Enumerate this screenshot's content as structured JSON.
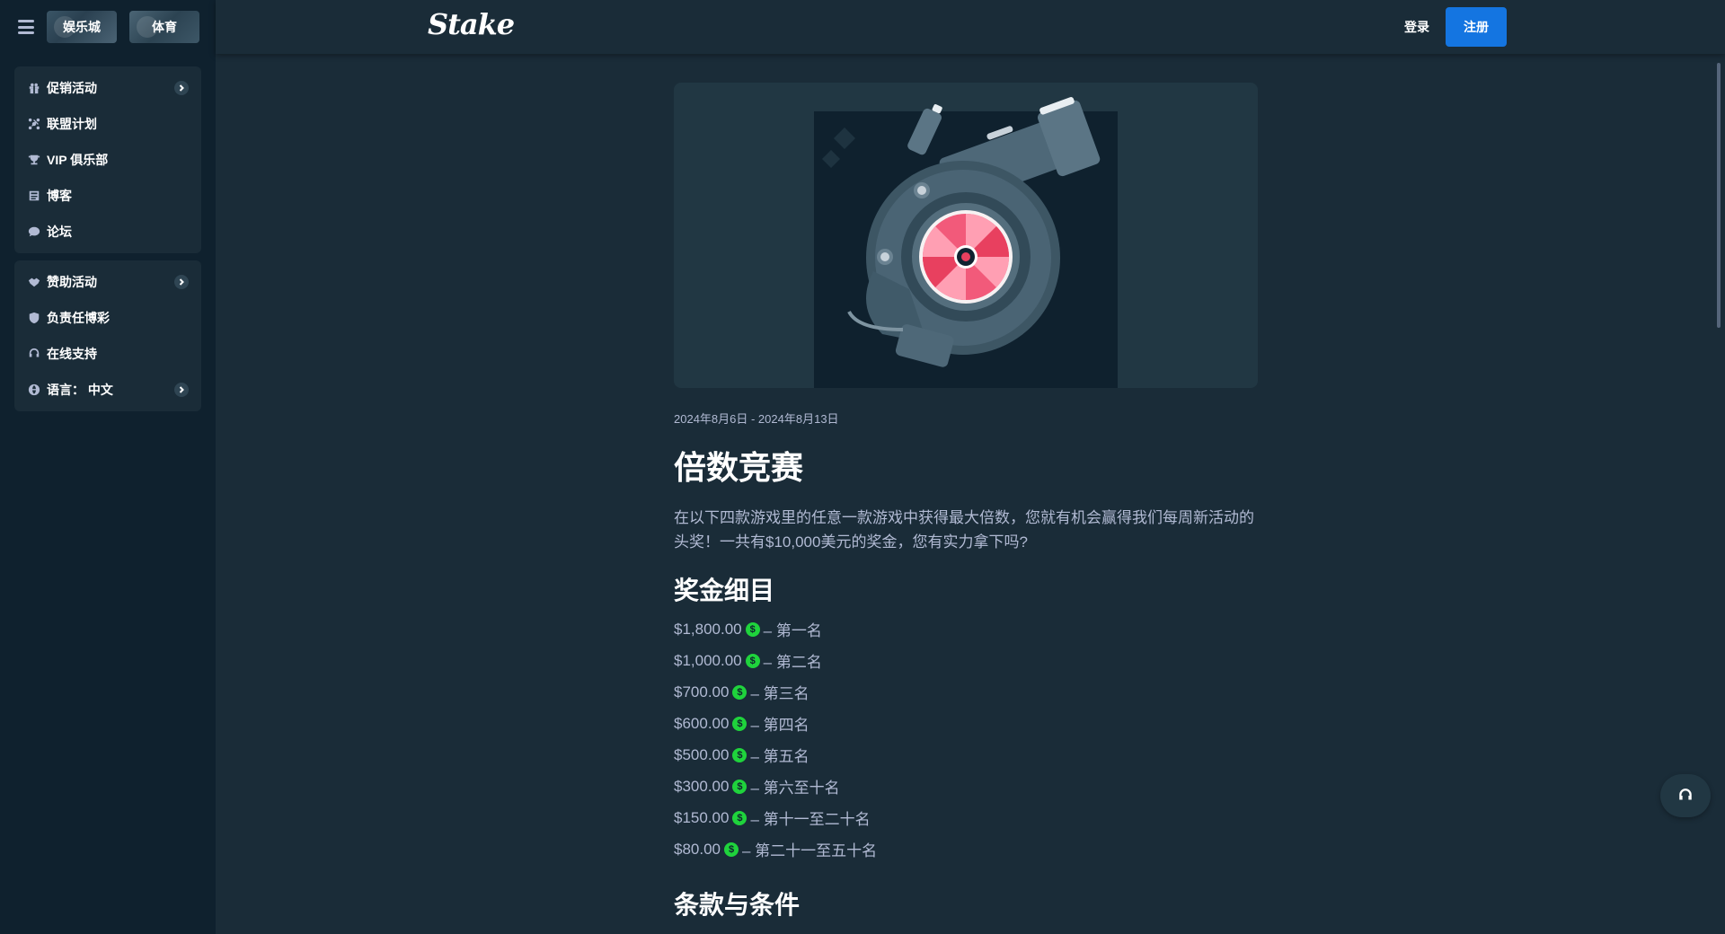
{
  "nav": {
    "casino_tab": "娱乐城",
    "sports_tab": "体育",
    "group1": [
      {
        "label": "促销活动",
        "icon": "gift-icon",
        "chevron": true
      },
      {
        "label": "联盟计划",
        "icon": "affiliate-icon",
        "chevron": false
      },
      {
        "label": "VIP 俱乐部",
        "icon": "trophy-icon",
        "chevron": false
      },
      {
        "label": "博客",
        "icon": "blog-icon",
        "chevron": false
      },
      {
        "label": "论坛",
        "icon": "chat-icon",
        "chevron": false
      }
    ],
    "group2": [
      {
        "label": "赞助活动",
        "icon": "handshake-icon",
        "chevron": true
      },
      {
        "label": "负责任博彩",
        "icon": "shield-icon",
        "chevron": false
      },
      {
        "label": "在线支持",
        "icon": "headset-icon",
        "chevron": false
      },
      {
        "label": "语言： 中文",
        "icon": "globe-icon",
        "chevron": true
      }
    ]
  },
  "header": {
    "logo": "Stake",
    "login": "登录",
    "register": "注册"
  },
  "promo": {
    "date": "2024年8月6日 - 2024年8月13日",
    "title": "倍数竞赛",
    "intro": "在以下四款游戏里的任意一款游戏中获得最大倍数，您就有机会赢得我们每周新活动的头奖！一共有$10,000美元的奖金，您有实力拿下吗?",
    "prize_heading": "奖金细目",
    "coin_symbol": "$",
    "prizes": [
      {
        "amount": "$1,800.00",
        "rank": "– 第一名"
      },
      {
        "amount": "$1,000.00",
        "rank": "– 第二名"
      },
      {
        "amount": "$700.00",
        "rank": "– 第三名"
      },
      {
        "amount": "$600.00",
        "rank": "– 第四名"
      },
      {
        "amount": "$500.00",
        "rank": "– 第五名"
      },
      {
        "amount": "$300.00",
        "rank": "– 第六至十名"
      },
      {
        "amount": "$150.00",
        "rank": "– 第十一至二十名"
      },
      {
        "amount": "$80.00",
        "rank": "– 第二十一至五十名"
      }
    ],
    "terms_heading": "条款与条件"
  },
  "colors": {
    "bg": "#1a2c38",
    "sidebar": "#0f212e",
    "accent": "#1475e1",
    "coin": "#1fd33c",
    "muted_text": "#b1bad3"
  }
}
